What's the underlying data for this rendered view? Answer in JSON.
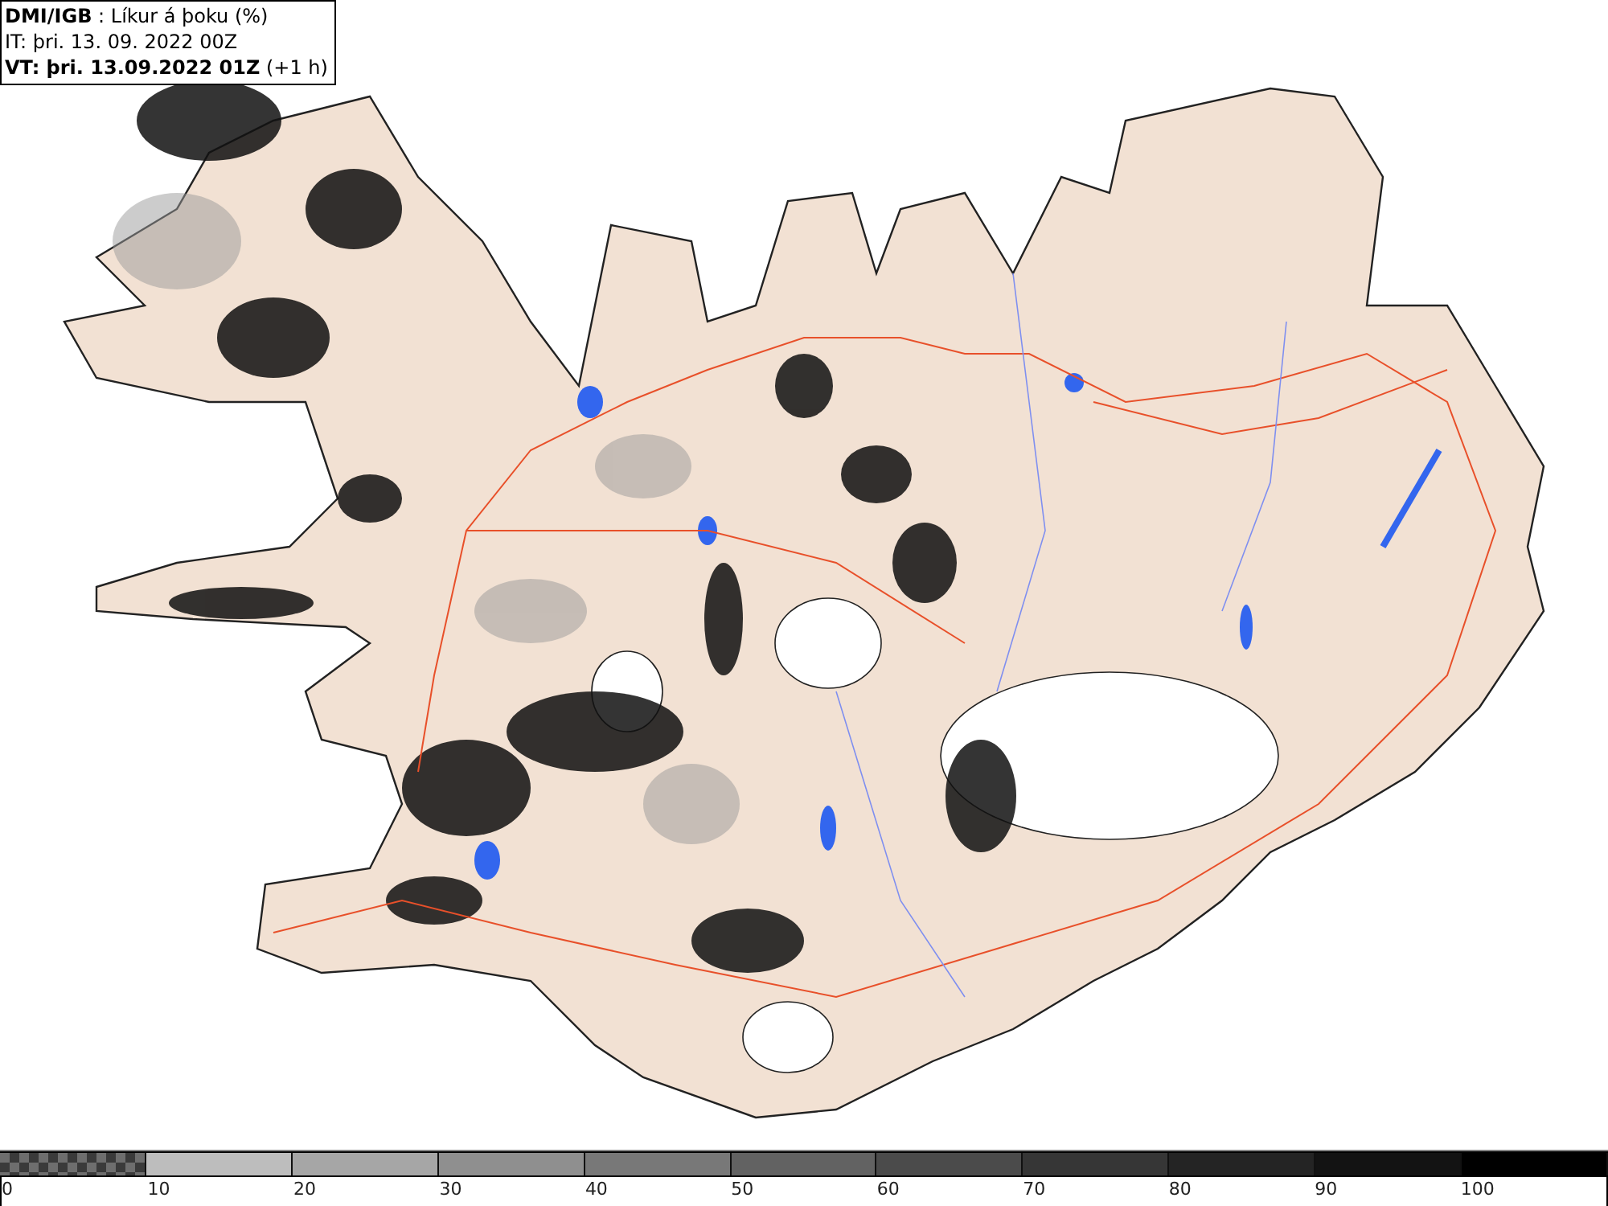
{
  "header": {
    "title": "**DMI/IGB** : Líkur á þoku (%)",
    "initial_time": "IT: þri. 13. 09. 2022 00Z",
    "valid_time": "**VT: þri. 13.09.2022 01Z** (+1 h)"
  },
  "legend": {
    "segments": [
      {
        "kind": "checker",
        "color": "#6e6e6e"
      },
      {
        "kind": "solid",
        "color": "#bdbdbd"
      },
      {
        "kind": "solid",
        "color": "#a6a6a6"
      },
      {
        "kind": "solid",
        "color": "#8f8f8f"
      },
      {
        "kind": "solid",
        "color": "#787878"
      },
      {
        "kind": "solid",
        "color": "#626262"
      },
      {
        "kind": "solid",
        "color": "#4b4b4b"
      },
      {
        "kind": "solid",
        "color": "#363636"
      },
      {
        "kind": "solid",
        "color": "#242424"
      },
      {
        "kind": "solid",
        "color": "#131313"
      },
      {
        "kind": "solid",
        "color": "#000000"
      }
    ],
    "labels": [
      "0",
      "10",
      "20",
      "30",
      "40",
      "50",
      "60",
      "70",
      "80",
      "90",
      "100"
    ]
  }
}
